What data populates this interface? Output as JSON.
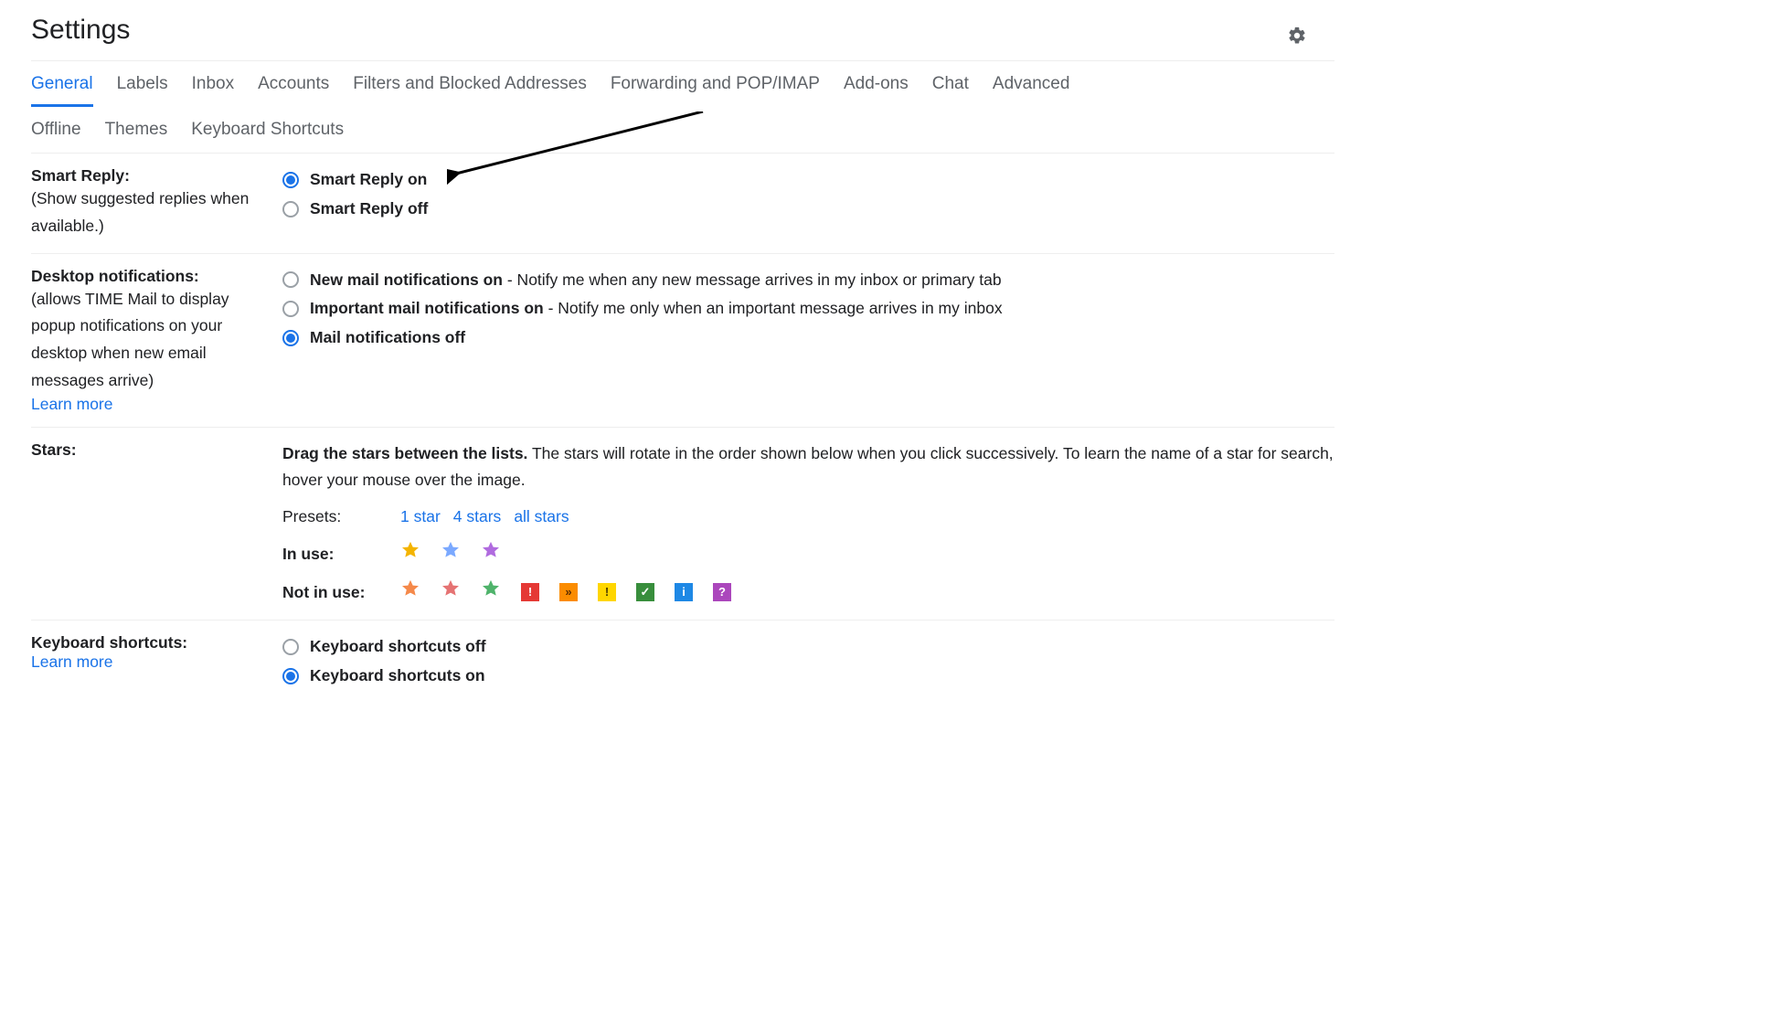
{
  "header": {
    "title": "Settings"
  },
  "tabs": [
    {
      "label": "General",
      "active": true
    },
    {
      "label": "Labels"
    },
    {
      "label": "Inbox"
    },
    {
      "label": "Accounts"
    },
    {
      "label": "Filters and Blocked Addresses"
    },
    {
      "label": "Forwarding and POP/IMAP"
    },
    {
      "label": "Add-ons"
    },
    {
      "label": "Chat"
    },
    {
      "label": "Advanced"
    },
    {
      "label": "Offline"
    },
    {
      "label": "Themes"
    },
    {
      "label": "Keyboard Shortcuts"
    }
  ],
  "smart_reply": {
    "title": "Smart Reply:",
    "desc": "(Show suggested replies when available.)",
    "options": [
      {
        "label": "Smart Reply on",
        "checked": true
      },
      {
        "label": "Smart Reply off",
        "checked": false
      }
    ]
  },
  "desktop_notifications": {
    "title": "Desktop notifications:",
    "desc": "(allows TIME Mail to display popup notifications on your desktop when new email messages arrive)",
    "learn_more": "Learn more",
    "options": [
      {
        "label_bold": "New mail notifications on",
        "label_rest": " - Notify me when any new message arrives in my inbox or primary tab",
        "checked": false
      },
      {
        "label_bold": "Important mail notifications on",
        "label_rest": " - Notify me only when an important message arrives in my inbox",
        "checked": false
      },
      {
        "label_bold": "Mail notifications off",
        "label_rest": "",
        "checked": true
      }
    ]
  },
  "stars": {
    "title": "Stars:",
    "intro_bold": "Drag the stars between the lists.",
    "intro_rest": "  The stars will rotate in the order shown below when you click successively. To learn the name of a star for search, hover your mouse over the image.",
    "presets_label": "Presets:",
    "presets": [
      "1 star",
      "4 stars",
      "all stars"
    ],
    "in_use_label": "In use:",
    "in_use": [
      {
        "type": "star",
        "color": "#f4b400",
        "name": "yellow-star-icon"
      },
      {
        "type": "star",
        "color": "#7ba9ff",
        "name": "blue-star-icon"
      },
      {
        "type": "star",
        "color": "#b06bdf",
        "name": "purple-star-icon"
      }
    ],
    "not_in_use_label": "Not in use:",
    "not_in_use": [
      {
        "type": "star",
        "color": "#f5894a",
        "name": "orange-star-icon"
      },
      {
        "type": "star",
        "color": "#e57373",
        "name": "red-star-icon"
      },
      {
        "type": "star",
        "color": "#4fb36b",
        "name": "green-star-icon"
      },
      {
        "type": "square",
        "bg": "#e53935",
        "fg": "#fff",
        "glyph": "!",
        "name": "red-bang-icon"
      },
      {
        "type": "square",
        "bg": "#fb8c00",
        "fg": "#5d2e00",
        "glyph": "»",
        "name": "orange-guillemet-icon"
      },
      {
        "type": "square",
        "bg": "#ffd600",
        "fg": "#4a3a00",
        "glyph": "!",
        "name": "yellow-bang-icon"
      },
      {
        "type": "square",
        "bg": "#388e3c",
        "fg": "#fff",
        "glyph": "✓",
        "name": "green-check-icon"
      },
      {
        "type": "square",
        "bg": "#1e88e5",
        "fg": "#fff",
        "glyph": "i",
        "name": "blue-info-icon"
      },
      {
        "type": "square",
        "bg": "#ab47bc",
        "fg": "#fff",
        "glyph": "?",
        "name": "purple-question-icon"
      }
    ]
  },
  "keyboard_shortcuts": {
    "title": "Keyboard shortcuts:",
    "learn_more": "Learn more",
    "options": [
      {
        "label": "Keyboard shortcuts off",
        "checked": false
      },
      {
        "label": "Keyboard shortcuts on",
        "checked": true
      }
    ]
  }
}
